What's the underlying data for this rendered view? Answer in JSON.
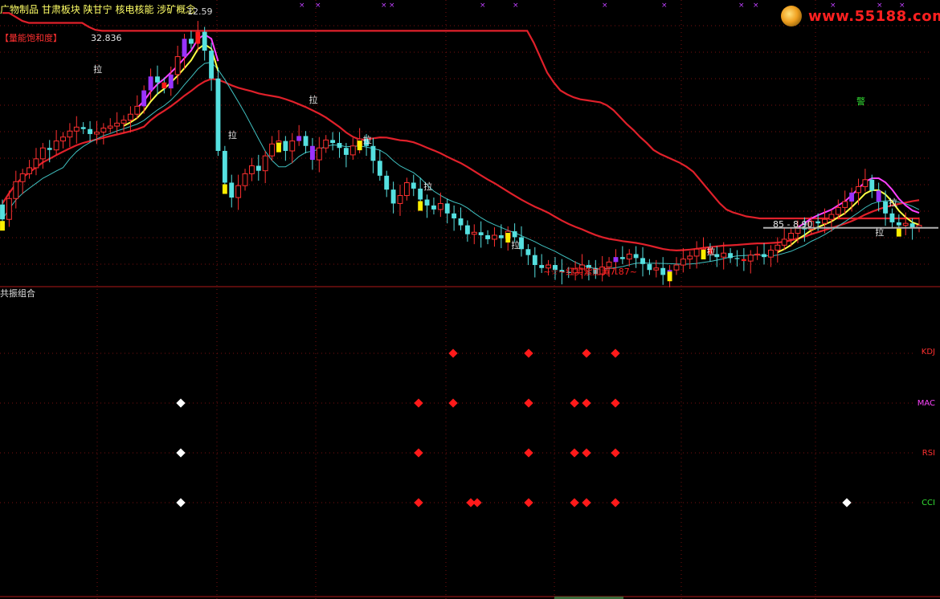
{
  "header": {
    "sectors": "广物制品 甘肃板块 陕甘宁 核电核能 涉矿概念",
    "price": "12.59",
    "indicator_tag": "【量能饱和度】",
    "max_price": "32.836"
  },
  "logo": {
    "text": "www.55188.com",
    "icon": "swirl-logo-icon"
  },
  "annotations": {
    "pull_label": "拉",
    "range": "85 - 8.90",
    "signal": "~☆~红买紫加黄7.87~",
    "warn": "警"
  },
  "lower_panel": {
    "title": "共振组合",
    "rows": [
      "KDJ",
      "MAC",
      "RSI",
      "CCI"
    ],
    "row_colors": [
      "#ff3030",
      "#ff44ff",
      "#ff3030",
      "#33dd33"
    ]
  },
  "chart_data": [
    {
      "type": "candlestick",
      "title": "",
      "colors": {
        "up": "#ff3030",
        "down": "#55e0e0",
        "upper_band": "#e0202a",
        "ma_fast": "#ffff44",
        "ma_mid": "#ff40ff",
        "ma_slow": "#40c0c0",
        "current_price_line": "#b0b0b0"
      },
      "ylim": [
        6.5,
        34.5
      ],
      "current_price": 12.59,
      "range_low": 8.85,
      "range_high": 8.9,
      "signal_price": 7.87,
      "close": [
        13.2,
        15.3,
        17.0,
        17.8,
        18.4,
        19.3,
        20.4,
        20.2,
        21.1,
        21.5,
        22.1,
        22.5,
        22.3,
        21.8,
        22.0,
        22.4,
        22.6,
        22.9,
        23.2,
        23.8,
        24.6,
        26.2,
        27.6,
        27.0,
        26.4,
        27.8,
        29.6,
        31.4,
        30.9,
        32.1,
        30.2,
        27.4,
        20.1,
        16.9,
        15.4,
        16.6,
        17.8,
        18.6,
        18.1,
        19.6,
        20.8,
        21.1,
        20.1,
        21.1,
        21.6,
        20.6,
        19.2,
        20.4,
        21.2,
        20.9,
        20.4,
        19.7,
        20.6,
        21.3,
        20.6,
        19.1,
        17.6,
        16.2,
        14.8,
        15.6,
        16.9,
        16.3,
        15.2,
        14.6,
        14.2,
        14.8,
        13.8,
        13.3,
        12.6,
        11.7,
        11.9,
        11.6,
        11.2,
        11.6,
        11.3,
        12.0,
        11.4,
        10.2,
        9.6,
        8.6,
        8.3,
        8.6,
        8.1,
        7.9,
        7.8,
        8.2,
        8.6,
        8.3,
        7.7,
        8.4,
        8.9,
        9.4,
        9.2,
        9.7,
        9.3,
        8.7,
        8.1,
        8.3,
        7.6,
        8.1,
        8.6,
        9.2,
        9.5,
        10.2,
        10.3,
        9.7,
        9.4,
        9.8,
        9.3,
        9.2,
        9.0,
        9.6,
        9.7,
        9.4,
        10.1,
        10.6,
        11.2,
        11.8,
        12.3,
        12.2,
        13.0,
        12.8,
        13.2,
        13.7,
        14.4,
        15.0,
        15.9,
        16.5,
        17.2,
        16.1,
        15.0,
        13.8,
        12.9,
        12.6,
        12.8,
        12.4,
        12.6
      ],
      "series": [
        {
          "name": "",
          "kind": "band",
          "values": [
            34,
            34,
            33.6,
            33.2,
            33,
            33,
            33,
            33,
            33,
            33,
            33,
            33,
            33,
            32.6,
            32.3,
            32.2,
            32.2,
            32.2,
            32.2,
            32.2,
            32.2,
            32.2,
            32.2,
            32.2,
            32.2,
            32.2,
            32.2,
            32.2,
            32.2,
            32.2,
            32.2,
            32.2,
            32.2,
            32.2,
            32.2,
            32.2,
            32.2,
            32.2,
            32.2,
            32.2,
            32.2,
            32.2,
            32.2,
            32.2,
            32.2,
            32.2,
            32.2,
            32.2,
            32.2,
            32.2,
            32.2,
            32.2,
            32.2,
            32.2,
            32.2,
            32.2,
            32.2,
            32.2,
            32.2,
            32.2,
            32.2,
            32.2,
            32.2,
            32.2,
            32.2,
            32.2,
            32.2,
            32.2,
            32.2,
            32.2,
            32.2,
            32.2,
            32.2,
            32.2,
            32.2,
            32.2,
            32.2,
            32.2,
            32.2,
            32.2,
            31.0,
            29.5,
            28,
            27,
            26.2,
            25.8,
            25.5,
            25.3,
            25.2,
            25.1,
            25.0,
            24.7,
            24.2,
            23.5,
            22.8,
            22.2,
            21.5,
            20.9,
            20.2,
            19.8,
            19.5,
            19.2,
            18.9,
            18.5,
            18.0,
            17.2,
            16.4,
            15.6,
            14.8,
            14.2,
            13.9,
            13.7,
            13.5,
            13.4,
            13.3,
            13.3,
            13.3,
            13.3,
            13.3,
            13.3,
            13.3,
            13.3,
            13.3,
            13.3,
            13.3,
            13.3,
            13.3,
            13.3,
            13.3,
            13.3,
            13.3,
            13.3,
            13.3,
            13.3,
            13.3,
            13.3,
            13.3,
            13.3,
            13.3
          ]
        },
        {
          "name": "",
          "kind": "ma",
          "color_key": "ma_slow"
        },
        {
          "name": "",
          "kind": "ma",
          "color_key": "ma_fast"
        },
        {
          "name": "",
          "kind": "ma",
          "color_key": "ma_mid"
        }
      ]
    },
    {
      "type": "scatter",
      "title": "共振组合",
      "categories": [
        "KDJ",
        "MAC",
        "RSI",
        "CCI"
      ],
      "series": [
        {
          "name": "KDJ",
          "color": "#ff1a1a",
          "x": [
            564,
            658,
            730,
            766
          ],
          "white_x": []
        },
        {
          "name": "MAC",
          "color": "#ff1a1a",
          "x": [
            521,
            564,
            658,
            715,
            730,
            766
          ],
          "white_x": [
            225
          ]
        },
        {
          "name": "RSI",
          "color": "#ff1a1a",
          "x": [
            521,
            658,
            715,
            730,
            766
          ],
          "white_x": [
            225
          ]
        },
        {
          "name": "CCI",
          "color": "#ff1a1a",
          "x": [
            521,
            586,
            594,
            658,
            715,
            730,
            766
          ],
          "white_x": [
            225,
            1054
          ]
        }
      ]
    }
  ]
}
